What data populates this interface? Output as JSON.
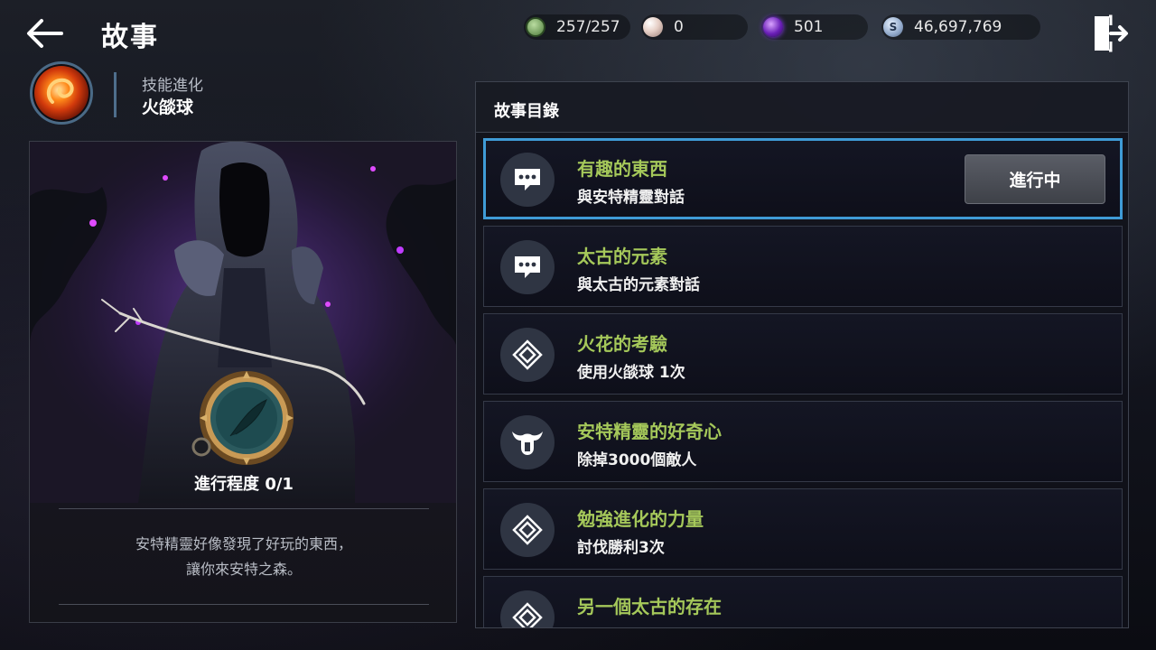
{
  "header": {
    "title": "故事",
    "back_icon": "back-arrow-icon",
    "exit_icon": "exit-door-icon"
  },
  "currencies": [
    {
      "name": "stamina",
      "icon": "stamina-leaf-icon",
      "value": "257/257",
      "color": "#6e9b52"
    },
    {
      "name": "pearl",
      "icon": "pearl-icon",
      "value": "0",
      "color": "#e6cfc6"
    },
    {
      "name": "orb",
      "icon": "purple-orb-icon",
      "value": "501",
      "color": "#7a2ad0"
    },
    {
      "name": "silver",
      "icon": "silver-coin-icon",
      "value": "46,697,769",
      "color": "#8fa7c9",
      "symbol": "S"
    }
  ],
  "skill": {
    "category": "技能進化",
    "name": "火燄球",
    "icon": "fireball-skill-icon"
  },
  "detail": {
    "progress_text": "進行程度 0/1",
    "description_line1": "安特精靈好像發現了好玩的東西，",
    "description_line2": "讓你來安特之森。",
    "medal_icon": "feather-medal-icon"
  },
  "story_list": {
    "title": "故事目錄",
    "status_label": "進行中",
    "entries": [
      {
        "title": "有趣的東西",
        "subtitle": "與安特精靈對話",
        "icon": "chat-bubble-icon",
        "active": true
      },
      {
        "title": "太古的元素",
        "subtitle": "與太古的元素對話",
        "icon": "chat-bubble-icon",
        "active": false
      },
      {
        "title": "火花的考驗",
        "subtitle": "使用火燄球 1次",
        "icon": "diamond-rune-icon",
        "active": false
      },
      {
        "title": "安特精靈的好奇心",
        "subtitle": "除掉3000個敵人",
        "icon": "horned-helmet-icon",
        "active": false
      },
      {
        "title": "勉強進化的力量",
        "subtitle": "討伐勝利3次",
        "icon": "diamond-rune-icon",
        "active": false
      },
      {
        "title": "另一個太古的存在",
        "subtitle": "",
        "icon": "diamond-rune-icon",
        "active": false
      }
    ]
  },
  "colors": {
    "quest_title": "#a5c85a",
    "active_border": "#3f9bd6",
    "panel_border": "#3e434f"
  }
}
